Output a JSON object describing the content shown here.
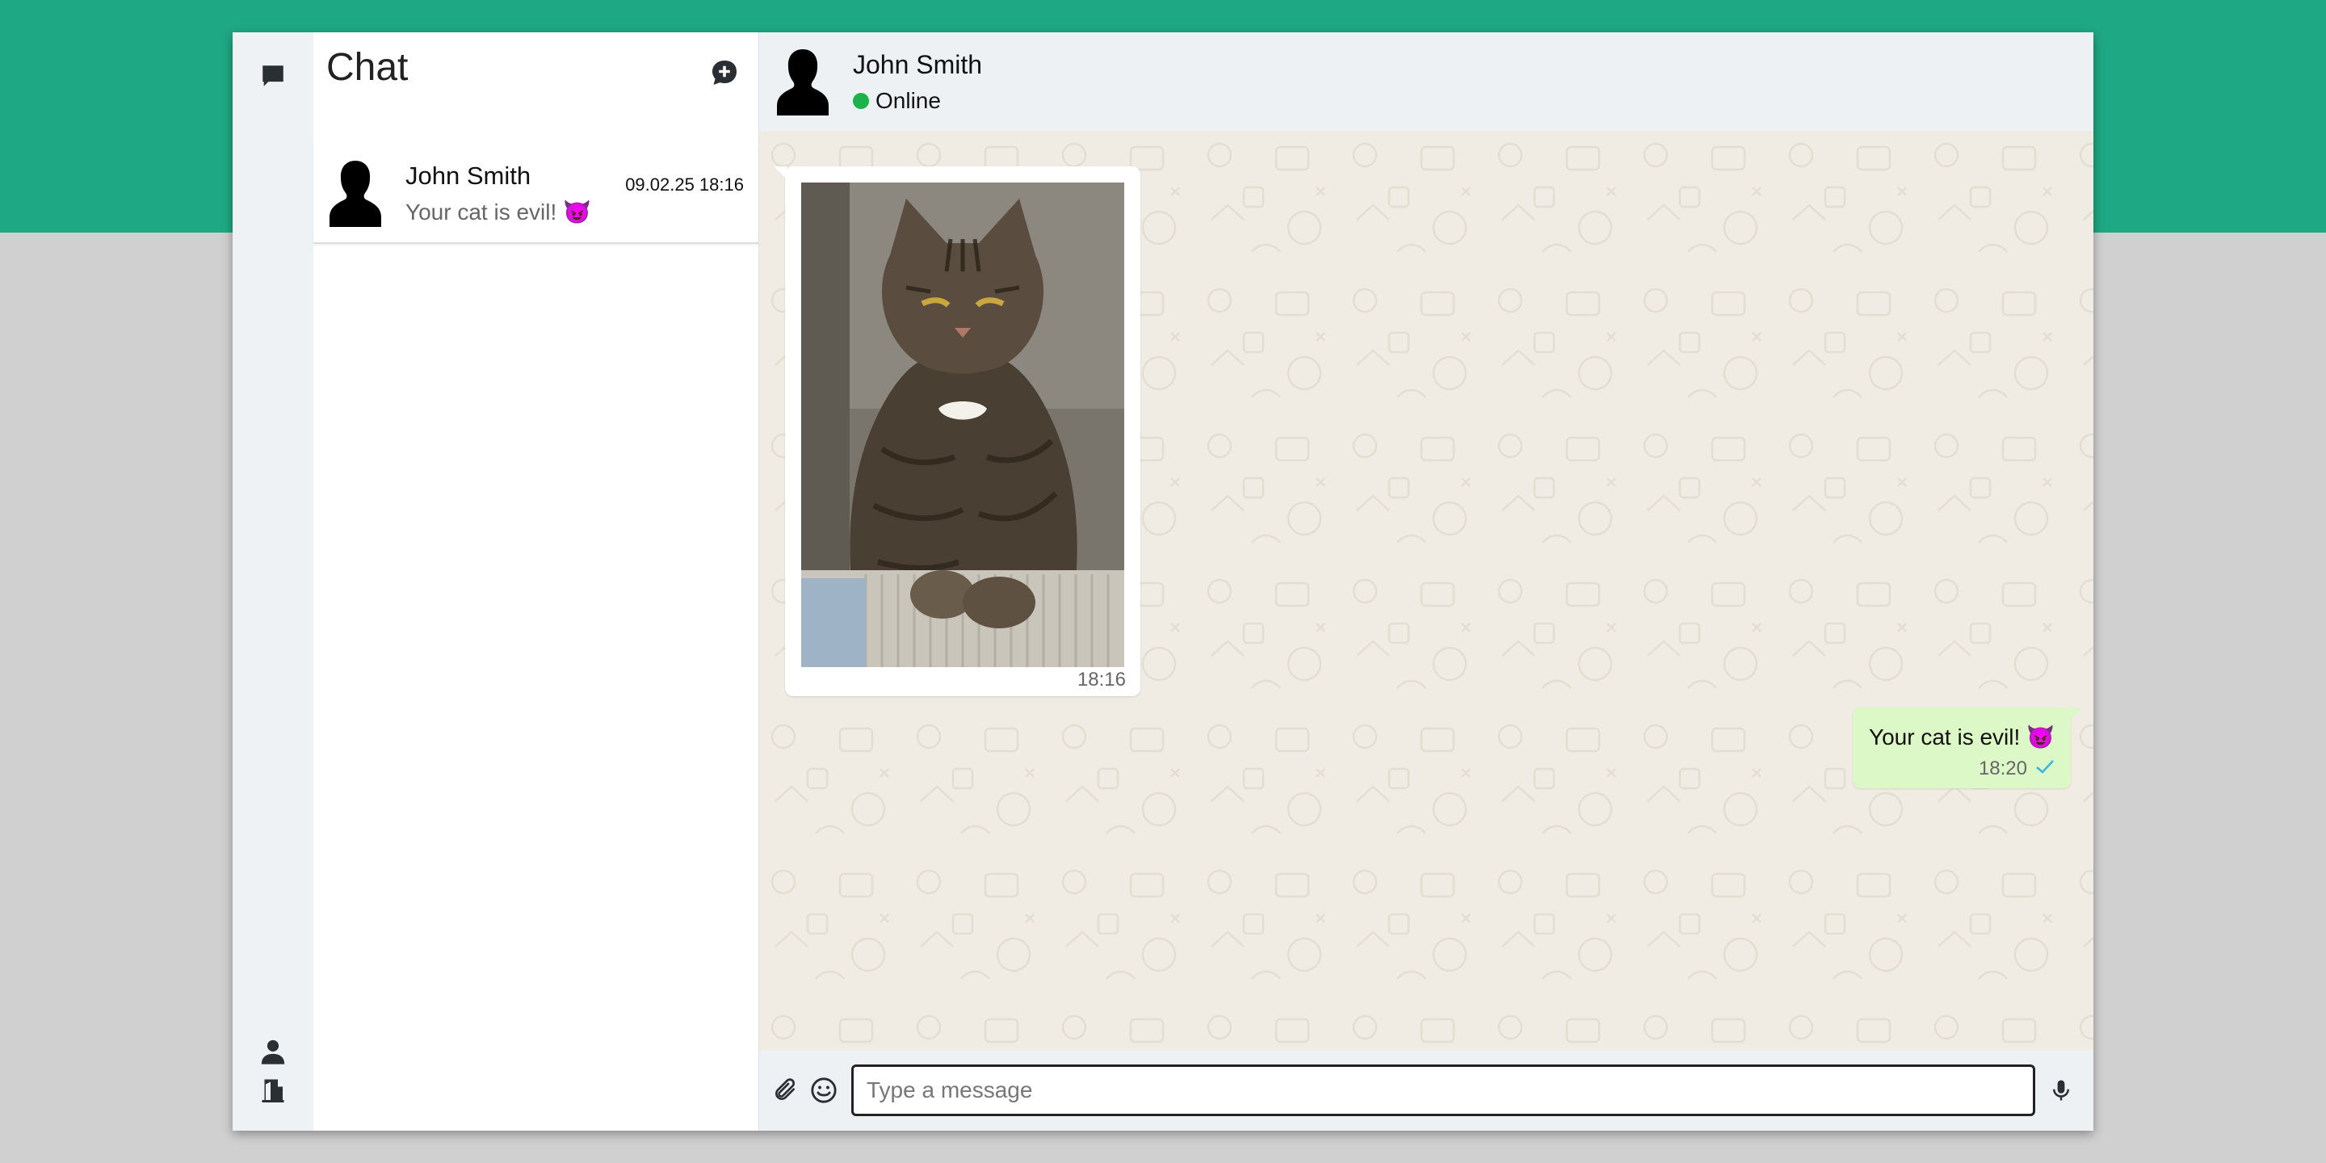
{
  "app": {
    "accent_color": "#1fa884",
    "background_color": "#d0d0d0"
  },
  "rail": {
    "top_icon": "chat-bubble-icon",
    "bottom_icons": [
      "person-icon",
      "logout-door-icon"
    ]
  },
  "sidebar": {
    "title": "Chat",
    "new_chat_icon": "new-chat-icon",
    "chats": [
      {
        "name": "John Smith",
        "last_message": "Your cat is evil! 😈",
        "timestamp": "09.02.25 18:16"
      }
    ]
  },
  "conversation": {
    "contact_name": "John Smith",
    "status": "Online",
    "status_color": "#1cb34b",
    "messages": [
      {
        "direction": "incoming",
        "type": "image",
        "image": "photo of a tabby cat",
        "time": "18:16"
      },
      {
        "direction": "outgoing",
        "type": "text",
        "text": "Your cat is evil! 😈",
        "time": "18:20",
        "status_icon": "check-icon"
      }
    ]
  },
  "composer": {
    "placeholder": "Type a message",
    "value": "",
    "icons": [
      "paperclip-icon",
      "emoji-icon",
      "microphone-icon"
    ]
  }
}
